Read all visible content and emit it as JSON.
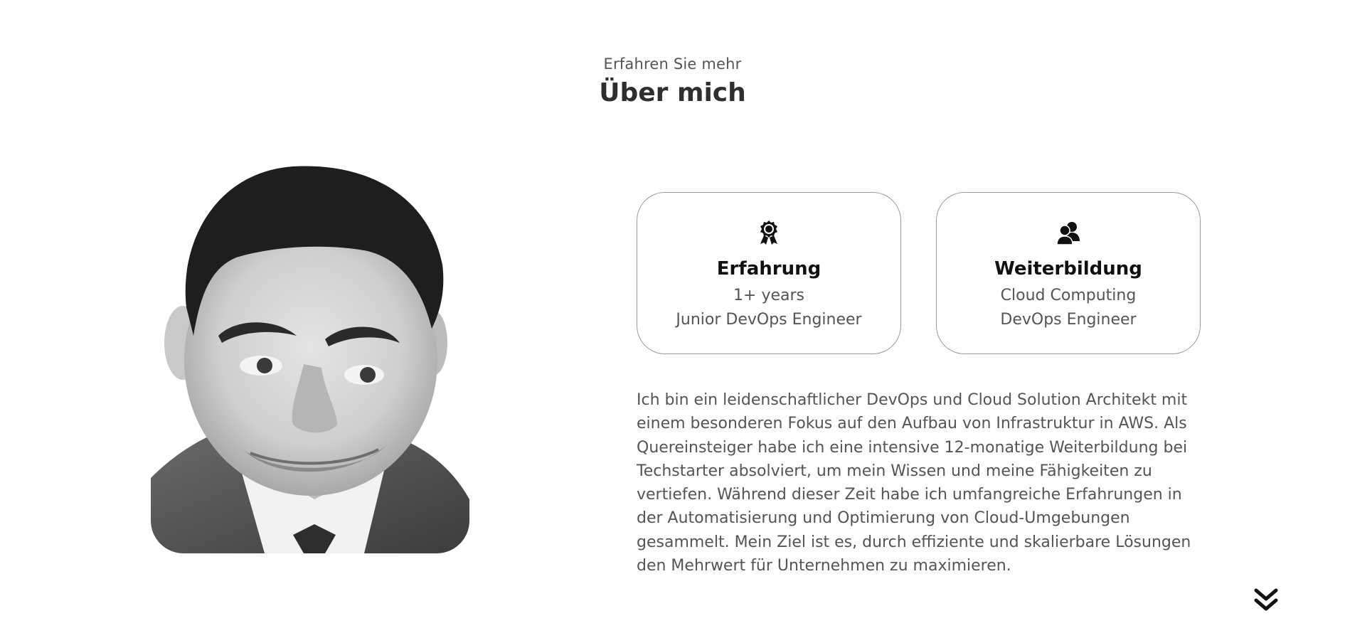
{
  "header": {
    "subtitle": "Erfahren Sie mehr",
    "title": "Über mich"
  },
  "cards": [
    {
      "icon": "award-ribbon-icon",
      "title": "Erfahrung",
      "line1": "1+ years",
      "line2": "Junior DevOps Engineer"
    },
    {
      "icon": "user-group-icon",
      "title": "Weiterbildung",
      "line1": "Cloud Computing",
      "line2": "DevOps Engineer"
    }
  ],
  "description": "Ich bin ein leidenschaftlicher DevOps und Cloud Solution Architekt mit einem besonderen Fokus auf den Aufbau von Infrastruktur in AWS. Als Quereinsteiger habe ich eine intensive 12-monatige Weiterbildung bei Techstarter absolviert, um mein Wissen und meine Fähigkeiten zu vertiefen. Während dieser Zeit habe ich umfangreiche Erfahrungen in der Automatisierung und Optimierung von Cloud-Umgebungen gesammelt. Mein Ziel ist es, durch effiziente und skalierbare Lösungen den Mehrwert für Unternehmen zu maximieren.",
  "scroll": {
    "icon": "double-chevron-down-icon"
  },
  "colors": {
    "text": "#555555",
    "heading": "#2f2f2f",
    "card_border": "#9a9a9a",
    "icon": "#111111"
  }
}
